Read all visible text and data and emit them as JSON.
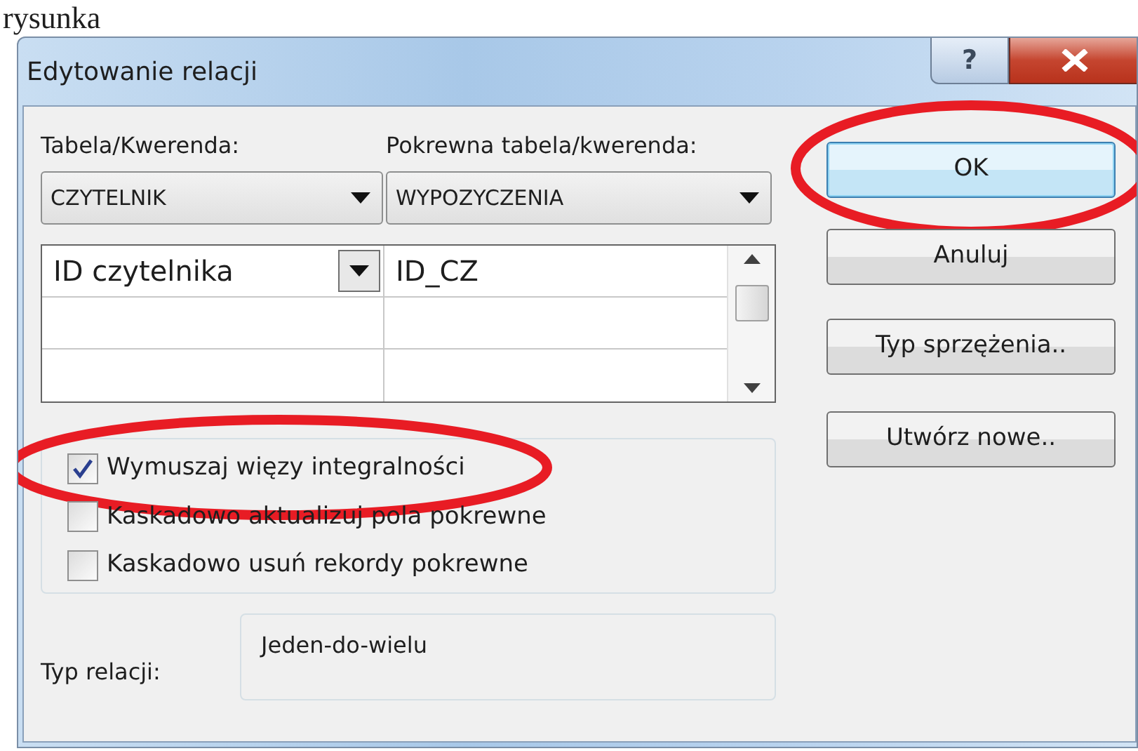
{
  "page_caption": "rysunka",
  "window": {
    "title": "Edytowanie relacji",
    "help": "?"
  },
  "table_label": "Tabela/Kwerenda:",
  "table": "CZYTELNIK",
  "related_label": "Pokrewna tabela/kwerenda:",
  "related_table": "WYPOZYCZENIA",
  "fields": [
    {
      "field": "ID czytelnika",
      "related_field": "ID_CZ",
      "focused": true
    }
  ],
  "options": [
    {
      "label": "Wymuszaj więzy integralności",
      "checked": true,
      "circled": true
    },
    {
      "label": "Kaskadowo aktualizuj pola pokrewne",
      "checked": false,
      "circled": false
    },
    {
      "label": "Kaskadowo usuń rekordy pokrewne",
      "checked": false,
      "circled": false
    }
  ],
  "relation_type_label": "Typ relacji:",
  "relation_type": "Jeden-do-wielu",
  "buttons": [
    {
      "label": "OK",
      "default": true,
      "circled": true
    },
    {
      "label": "Anuluj",
      "default": false,
      "circled": false
    },
    {
      "label": "Typ sprzężenia..",
      "default": false,
      "circled": false
    },
    {
      "label": "Utwórz nowe..",
      "default": false,
      "circled": false
    }
  ]
}
